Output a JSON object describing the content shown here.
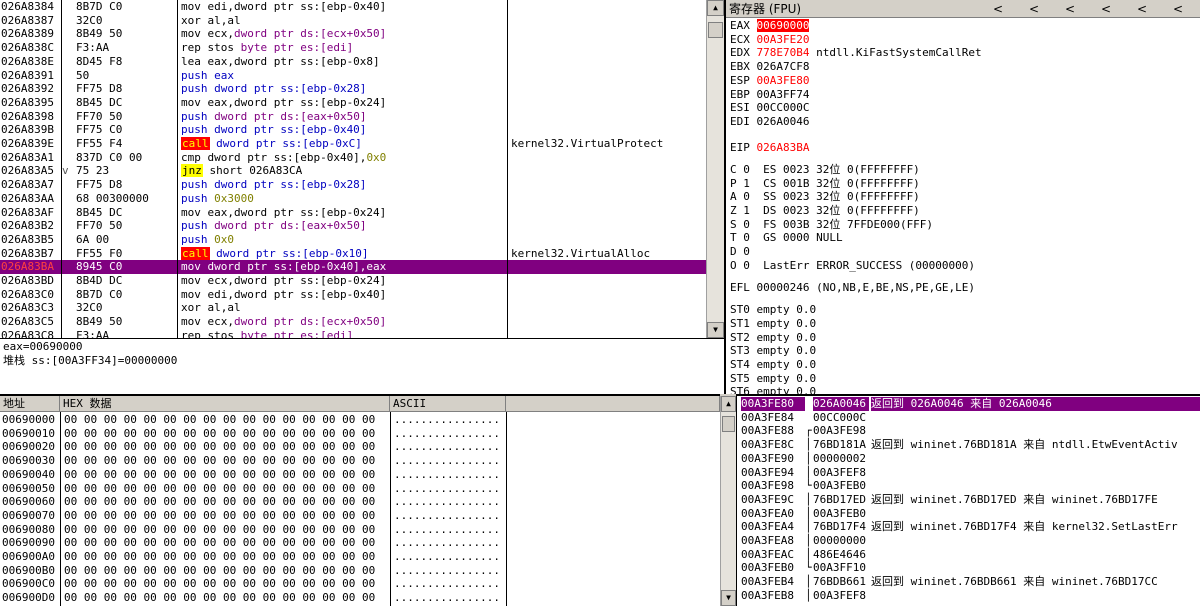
{
  "disasm": {
    "selected_index": 19,
    "rows": [
      {
        "addr": "026A8384",
        "mark": "",
        "hex": "8B7D C0",
        "asm": [
          {
            "t": "mov edi,dword ptr ss:[ebp-0x40]",
            "c": "k-mov"
          }
        ],
        "cmt": ""
      },
      {
        "addr": "026A8387",
        "mark": "",
        "hex": "32C0",
        "asm": [
          {
            "t": "xor al,al",
            "c": "k-mov"
          }
        ],
        "cmt": ""
      },
      {
        "addr": "026A8389",
        "mark": "",
        "hex": "8B49 50",
        "asm": [
          {
            "t": "mov ecx,",
            "c": "k-mov"
          },
          {
            "t": "dword ptr ds:[ecx+0x50]",
            "c": "k-arg-purple"
          }
        ],
        "cmt": ""
      },
      {
        "addr": "026A838C",
        "mark": "",
        "hex": "F3:AA",
        "asm": [
          {
            "t": "rep stos ",
            "c": "k-mov"
          },
          {
            "t": "byte ptr es:[edi]",
            "c": "k-arg-purple"
          }
        ],
        "cmt": ""
      },
      {
        "addr": "026A838E",
        "mark": "",
        "hex": "8D45 F8",
        "asm": [
          {
            "t": "lea eax,dword ptr ss:[ebp-0x8]",
            "c": "k-mov"
          }
        ],
        "cmt": ""
      },
      {
        "addr": "026A8391",
        "mark": "",
        "hex": "50",
        "asm": [
          {
            "t": "push eax",
            "c": "k-push"
          }
        ],
        "cmt": ""
      },
      {
        "addr": "026A8392",
        "mark": "",
        "hex": "FF75 D8",
        "asm": [
          {
            "t": "push dword ptr ss:[ebp-0x28]",
            "c": "k-push"
          }
        ],
        "cmt": ""
      },
      {
        "addr": "026A8395",
        "mark": "",
        "hex": "8B45 DC",
        "asm": [
          {
            "t": "mov eax,dword ptr ss:[ebp-0x24]",
            "c": "k-mov"
          }
        ],
        "cmt": ""
      },
      {
        "addr": "026A8398",
        "mark": "",
        "hex": "FF70 50",
        "asm": [
          {
            "t": "push ",
            "c": "k-push"
          },
          {
            "t": "dword ptr ds:[eax+0x50]",
            "c": "k-arg-purple"
          }
        ],
        "cmt": ""
      },
      {
        "addr": "026A839B",
        "mark": "",
        "hex": "FF75 C0",
        "asm": [
          {
            "t": "push dword ptr ss:[ebp-0x40]",
            "c": "k-push"
          }
        ],
        "cmt": ""
      },
      {
        "addr": "026A839E",
        "mark": "",
        "hex": "FF55 F4",
        "asm": [
          {
            "t": "call",
            "c": "k-call"
          },
          {
            "t": " dword ptr ss:[ebp-0xC]",
            "c": "k-push"
          }
        ],
        "cmt": "kernel32.VirtualProtect"
      },
      {
        "addr": "026A83A1",
        "mark": "",
        "hex": "837D C0 00",
        "asm": [
          {
            "t": "cmp dword ptr ss:[ebp-0x40],",
            "c": "k-mov"
          },
          {
            "t": "0x0",
            "c": "k-num"
          }
        ],
        "cmt": ""
      },
      {
        "addr": "026A83A5",
        "mark": "v",
        "hex": "75 23",
        "asm": [
          {
            "t": "jnz",
            "c": "k-jmp"
          },
          {
            "t": " short 026A83CA",
            "c": "k-mov"
          }
        ],
        "cmt": ""
      },
      {
        "addr": "026A83A7",
        "mark": "",
        "hex": "FF75 D8",
        "asm": [
          {
            "t": "push dword ptr ss:[ebp-0x28]",
            "c": "k-push"
          }
        ],
        "cmt": ""
      },
      {
        "addr": "026A83AA",
        "mark": "",
        "hex": "68 00300000",
        "asm": [
          {
            "t": "push ",
            "c": "k-push"
          },
          {
            "t": "0x3000",
            "c": "k-num"
          }
        ],
        "cmt": ""
      },
      {
        "addr": "026A83AF",
        "mark": "",
        "hex": "8B45 DC",
        "asm": [
          {
            "t": "mov eax,dword ptr ss:[ebp-0x24]",
            "c": "k-mov"
          }
        ],
        "cmt": ""
      },
      {
        "addr": "026A83B2",
        "mark": "",
        "hex": "FF70 50",
        "asm": [
          {
            "t": "push ",
            "c": "k-push"
          },
          {
            "t": "dword ptr ds:[eax+0x50]",
            "c": "k-arg-purple"
          }
        ],
        "cmt": ""
      },
      {
        "addr": "026A83B5",
        "mark": "",
        "hex": "6A 00",
        "asm": [
          {
            "t": "push ",
            "c": "k-push"
          },
          {
            "t": "0x0",
            "c": "k-num"
          }
        ],
        "cmt": ""
      },
      {
        "addr": "026A83B7",
        "mark": "",
        "hex": "FF55 F0",
        "asm": [
          {
            "t": "call",
            "c": "k-call"
          },
          {
            "t": " dword ptr ss:[ebp-0x10]",
            "c": "k-push"
          }
        ],
        "cmt": "kernel32.VirtualAlloc"
      },
      {
        "addr": "026A83BA",
        "mark": "",
        "hex": "8945 C0",
        "asm": [
          {
            "t": "mov dword ptr ss:[ebp-0x40],eax",
            "c": ""
          }
        ],
        "cmt": ""
      },
      {
        "addr": "026A83BD",
        "mark": "",
        "hex": "8B4D DC",
        "asm": [
          {
            "t": "mov ecx,dword ptr ss:[ebp-0x24]",
            "c": "k-mov"
          }
        ],
        "cmt": ""
      },
      {
        "addr": "026A83C0",
        "mark": "",
        "hex": "8B7D C0",
        "asm": [
          {
            "t": "mov edi,dword ptr ss:[ebp-0x40]",
            "c": "k-mov"
          }
        ],
        "cmt": ""
      },
      {
        "addr": "026A83C3",
        "mark": "",
        "hex": "32C0",
        "asm": [
          {
            "t": "xor al,al",
            "c": "k-mov"
          }
        ],
        "cmt": ""
      },
      {
        "addr": "026A83C5",
        "mark": "",
        "hex": "8B49 50",
        "asm": [
          {
            "t": "mov ecx,",
            "c": "k-mov"
          },
          {
            "t": "dword ptr ds:[ecx+0x50]",
            "c": "k-arg-purple"
          }
        ],
        "cmt": ""
      },
      {
        "addr": "026A83C8",
        "mark": "",
        "hex": "F3:AA",
        "asm": [
          {
            "t": "rep stos ",
            "c": "k-mov"
          },
          {
            "t": "byte ptr es:[edi]",
            "c": "k-arg-purple"
          }
        ],
        "cmt": ""
      }
    ]
  },
  "info": {
    "line1": "eax=00690000",
    "line2": "堆栈 ss:[00A3FF34]=00000000"
  },
  "regs": {
    "title": "寄存器 (FPU)",
    "nav_buttons": [
      "<",
      "<",
      "<",
      "<",
      "<",
      "<"
    ],
    "gp": [
      {
        "name": "EAX",
        "val": "00690000",
        "style": "hl-red",
        "sym": ""
      },
      {
        "name": "ECX",
        "val": "00A3FE20",
        "style": "red",
        "sym": ""
      },
      {
        "name": "EDX",
        "val": "778E70B4",
        "style": "red",
        "sym": "ntdll.KiFastSystemCallRet"
      },
      {
        "name": "EBX",
        "val": "026A7CF8",
        "style": "",
        "sym": ""
      },
      {
        "name": "ESP",
        "val": "00A3FE80",
        "style": "red",
        "sym": ""
      },
      {
        "name": "EBP",
        "val": "00A3FF74",
        "style": "",
        "sym": ""
      },
      {
        "name": "ESI",
        "val": "00CC000C",
        "style": "",
        "sym": ""
      },
      {
        "name": "EDI",
        "val": "026A0046",
        "style": "",
        "sym": ""
      }
    ],
    "eip": {
      "name": "EIP",
      "val": "026A83BA"
    },
    "flags": [
      "C 0  ES 0023 32位 0(FFFFFFFF)",
      "P 1  CS 001B 32位 0(FFFFFFFF)",
      "A 0  SS 0023 32位 0(FFFFFFFF)",
      "Z 1  DS 0023 32位 0(FFFFFFFF)",
      "S 0  FS 003B 32位 7FFDE000(FFF)",
      "T 0  GS 0000 NULL",
      "D 0",
      "O 0  LastErr ERROR_SUCCESS (00000000)"
    ],
    "efl": "EFL 00000246 (NO,NB,E,BE,NS,PE,GE,LE)",
    "fpu": [
      "ST0 empty 0.0",
      "ST1 empty 0.0",
      "ST2 empty 0.0",
      "ST3 empty 0.0",
      "ST4 empty 0.0",
      "ST5 empty 0.0",
      "ST6 empty 0.0"
    ]
  },
  "hex": {
    "headers": {
      "addr": "地址",
      "hex": "HEX 数据",
      "ascii": "ASCII"
    },
    "rows": [
      {
        "addr": "00690000",
        "bytes": "00 00 00 00 00 00 00 00 00 00 00 00 00 00 00 00",
        "ascii": "................"
      },
      {
        "addr": "00690010",
        "bytes": "00 00 00 00 00 00 00 00 00 00 00 00 00 00 00 00",
        "ascii": "................"
      },
      {
        "addr": "00690020",
        "bytes": "00 00 00 00 00 00 00 00 00 00 00 00 00 00 00 00",
        "ascii": "................"
      },
      {
        "addr": "00690030",
        "bytes": "00 00 00 00 00 00 00 00 00 00 00 00 00 00 00 00",
        "ascii": "................"
      },
      {
        "addr": "00690040",
        "bytes": "00 00 00 00 00 00 00 00 00 00 00 00 00 00 00 00",
        "ascii": "................"
      },
      {
        "addr": "00690050",
        "bytes": "00 00 00 00 00 00 00 00 00 00 00 00 00 00 00 00",
        "ascii": "................"
      },
      {
        "addr": "00690060",
        "bytes": "00 00 00 00 00 00 00 00 00 00 00 00 00 00 00 00",
        "ascii": "................"
      },
      {
        "addr": "00690070",
        "bytes": "00 00 00 00 00 00 00 00 00 00 00 00 00 00 00 00",
        "ascii": "................"
      },
      {
        "addr": "00690080",
        "bytes": "00 00 00 00 00 00 00 00 00 00 00 00 00 00 00 00",
        "ascii": "................"
      },
      {
        "addr": "00690090",
        "bytes": "00 00 00 00 00 00 00 00 00 00 00 00 00 00 00 00",
        "ascii": "................"
      },
      {
        "addr": "006900A0",
        "bytes": "00 00 00 00 00 00 00 00 00 00 00 00 00 00 00 00",
        "ascii": "................"
      },
      {
        "addr": "006900B0",
        "bytes": "00 00 00 00 00 00 00 00 00 00 00 00 00 00 00 00",
        "ascii": "................"
      },
      {
        "addr": "006900C0",
        "bytes": "00 00 00 00 00 00 00 00 00 00 00 00 00 00 00 00",
        "ascii": "................"
      },
      {
        "addr": "006900D0",
        "bytes": "00 00 00 00 00 00 00 00 00 00 00 00 00 00 00 00",
        "ascii": "................"
      }
    ]
  },
  "stack": {
    "selected_index": 0,
    "rows": [
      {
        "addr": "00A3FE80",
        "br": "",
        "val": "026A0046",
        "cmt": "返回到 026A0046 来自 026A0046"
      },
      {
        "addr": "00A3FE84",
        "br": "",
        "val": "00CC000C",
        "cmt": ""
      },
      {
        "addr": "00A3FE88",
        "br": "┌",
        "val": "00A3FE98",
        "cmt": ""
      },
      {
        "addr": "00A3FE8C",
        "br": "│",
        "val": "76BD181A",
        "cmt": "返回到 wininet.76BD181A 来自 ntdll.EtwEventActiv"
      },
      {
        "addr": "00A3FE90",
        "br": "│",
        "val": "00000002",
        "cmt": ""
      },
      {
        "addr": "00A3FE94",
        "br": "│",
        "val": "00A3FEF8",
        "cmt": ""
      },
      {
        "addr": "00A3FE98",
        "br": "└",
        "val": "00A3FEB0",
        "cmt": ""
      },
      {
        "addr": "00A3FE9C",
        "br": "│",
        "val": "76BD17ED",
        "cmt": "返回到 wininet.76BD17ED 来自 wininet.76BD17FE"
      },
      {
        "addr": "00A3FEA0",
        "br": "│",
        "val": "00A3FEB0",
        "cmt": ""
      },
      {
        "addr": "00A3FEA4",
        "br": "│",
        "val": "76BD17F4",
        "cmt": "返回到 wininet.76BD17F4 来自 kernel32.SetLastErr"
      },
      {
        "addr": "00A3FEA8",
        "br": "│",
        "val": "00000000",
        "cmt": ""
      },
      {
        "addr": "00A3FEAC",
        "br": "│",
        "val": "486E4646",
        "cmt": ""
      },
      {
        "addr": "00A3FEB0",
        "br": "└",
        "val": "00A3FF10",
        "cmt": ""
      },
      {
        "addr": "00A3FEB4",
        "br": "│",
        "val": "76BDB661",
        "cmt": "返回到 wininet.76BDB661 来自 wininet.76BD17CC"
      },
      {
        "addr": "00A3FEB8",
        "br": "│",
        "val": "00A3FEF8",
        "cmt": ""
      }
    ]
  }
}
